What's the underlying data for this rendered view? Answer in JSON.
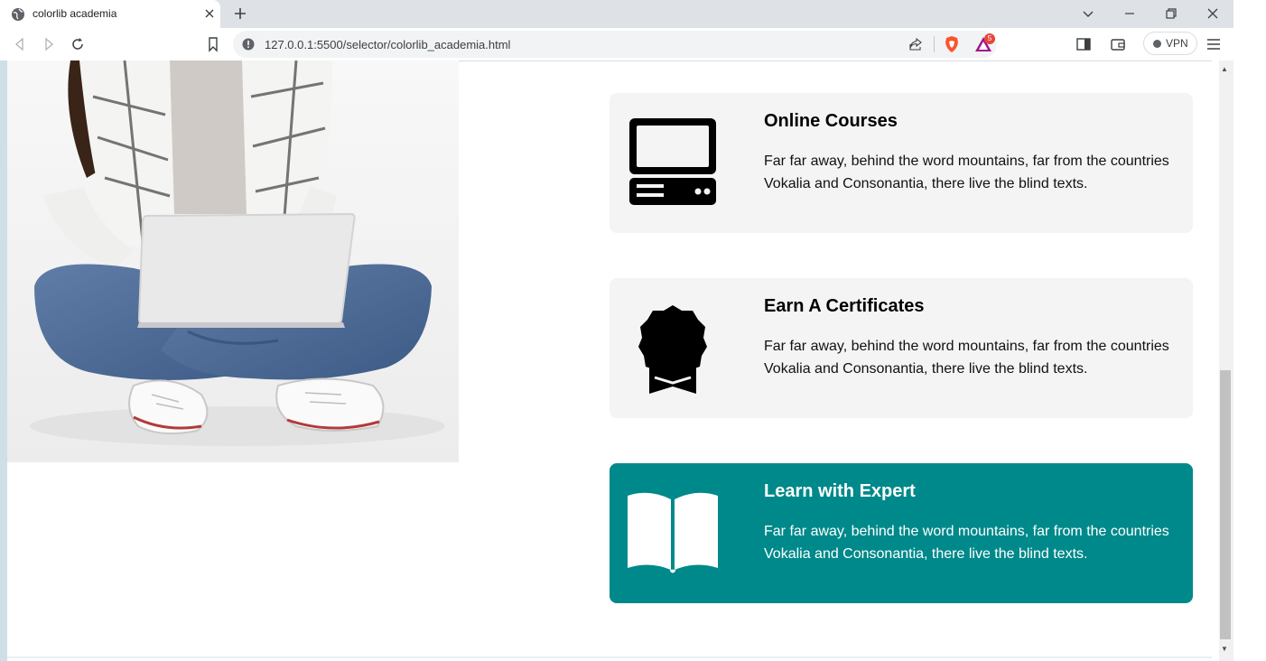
{
  "browser": {
    "tab_title": "colorlib academia",
    "url": "127.0.0.1:5500/selector/colorlib_academia.html",
    "rewards_badge": "5",
    "vpn_label": "VPN"
  },
  "hero": {
    "image_alt": "Woman sitting cross-legged with a laptop"
  },
  "features": [
    {
      "title": "Online Courses",
      "text": "Far far away, behind the word mountains, far from the countries Vokalia and Consonantia, there live the blind texts.",
      "icon": "computer-icon",
      "active": false
    },
    {
      "title": "Earn A Certificates",
      "text": "Far far away, behind the word mountains, far from the countries Vokalia and Consonantia, there live the blind texts.",
      "icon": "certificate-icon",
      "active": false
    },
    {
      "title": "Learn with Expert",
      "text": "Far far away, behind the word mountains, far from the countries Vokalia and Consonantia, there live the blind texts.",
      "icon": "book-icon",
      "active": true
    }
  ],
  "colors": {
    "accent": "#00898a",
    "card_bg": "#f4f4f4",
    "tabbar_bg": "#dee1e6"
  }
}
